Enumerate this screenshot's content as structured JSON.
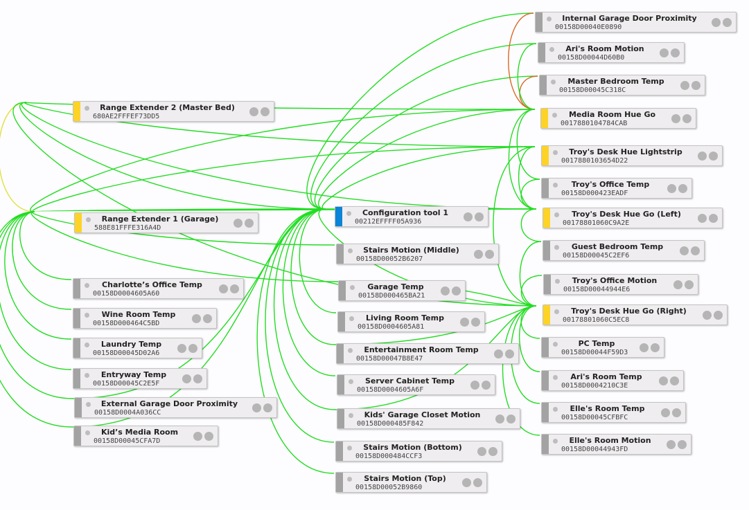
{
  "colors": {
    "router": "#fdd327",
    "coordinator": "#0a84d6",
    "end_device": "#a3a3a3",
    "link_good": "#22dd22",
    "link_weak": "#d96a2a",
    "link_mid": "#e0e040"
  },
  "nodes": [
    {
      "id": "igdp",
      "name": "Internal Garage Door Proximity",
      "ieee": "00158D00040E0890",
      "type": "end_device"
    },
    {
      "id": "arim",
      "name": "Ari's Room Motion",
      "ieee": "00158D00044D60B0",
      "type": "end_device"
    },
    {
      "id": "mbt",
      "name": "Master Bedroom Temp",
      "ieee": "00158D00045C318C",
      "type": "end_device"
    },
    {
      "id": "mrhg",
      "name": "Media Room Hue Go",
      "ieee": "0017880104784CAB",
      "type": "router"
    },
    {
      "id": "tdls",
      "name": "Troy's Desk Hue Lightstrip",
      "ieee": "0017880103654D22",
      "type": "router"
    },
    {
      "id": "tot",
      "name": "Troy's Office Temp",
      "ieee": "00158D000423EADF",
      "type": "end_device"
    },
    {
      "id": "tdgl",
      "name": "Troy's Desk Hue Go (Left)",
      "ieee": "00178801060C9A2E",
      "type": "router"
    },
    {
      "id": "gbt",
      "name": "Guest Bedroom Temp",
      "ieee": "00158D00045C2EF6",
      "type": "end_device"
    },
    {
      "id": "tom",
      "name": "Troy's Office Motion",
      "ieee": "00158D00044944E6",
      "type": "end_device"
    },
    {
      "id": "tdgr",
      "name": "Troy's Desk Hue Go (Right)",
      "ieee": "00178801060C5EC8",
      "type": "router"
    },
    {
      "id": "pct",
      "name": "PC Temp",
      "ieee": "00158D00044F59D3",
      "type": "end_device"
    },
    {
      "id": "arit",
      "name": "Ari's Room Temp",
      "ieee": "00158D0004210C3E",
      "type": "end_device"
    },
    {
      "id": "ellet",
      "name": "Elle's Room Temp",
      "ieee": "00158D00045CFBFC",
      "type": "end_device"
    },
    {
      "id": "ellem",
      "name": "Elle's Room Motion",
      "ieee": "00158D00044943FD",
      "type": "end_device"
    },
    {
      "id": "coord",
      "name": "Configuration tool 1",
      "ieee": "00212EFFFF05A936",
      "type": "coordinator"
    },
    {
      "id": "smm",
      "name": "Stairs Motion (Middle)",
      "ieee": "00158D00052B6207",
      "type": "end_device"
    },
    {
      "id": "gart",
      "name": "Garage Temp",
      "ieee": "00158D000465BA21",
      "type": "end_device"
    },
    {
      "id": "lrt",
      "name": "Living Room Temp",
      "ieee": "00158D0004605A81",
      "type": "end_device"
    },
    {
      "id": "ert",
      "name": "Entertainment Room Temp",
      "ieee": "00158D00047B8E47",
      "type": "end_device"
    },
    {
      "id": "sct",
      "name": "Server Cabinet Temp",
      "ieee": "00158D0004605A6F",
      "type": "end_device"
    },
    {
      "id": "kgcm",
      "name": "Kids' Garage Closet Motion",
      "ieee": "00158D000485F842",
      "type": "end_device"
    },
    {
      "id": "smb",
      "name": "Stairs Motion (Bottom)",
      "ieee": "00158D000484CCF3",
      "type": "end_device"
    },
    {
      "id": "smt",
      "name": "Stairs Motion (Top)",
      "ieee": "00158D00052B9860",
      "type": "end_device"
    },
    {
      "id": "re2",
      "name": "Range Extender 2 (Master Bed)",
      "ieee": "680AE2FFFEF73DD5",
      "type": "router"
    },
    {
      "id": "re1",
      "name": "Range Extender 1 (Garage)",
      "ieee": "588E81FFFE316A4D",
      "type": "router"
    },
    {
      "id": "cot",
      "name": "Charlotte’s Office Temp",
      "ieee": "00158D0004605A60",
      "type": "end_device"
    },
    {
      "id": "wrt",
      "name": "Wine Room Temp",
      "ieee": "00158D000464C5BD",
      "type": "end_device"
    },
    {
      "id": "lt",
      "name": "Laundry Temp",
      "ieee": "00158D00045D02A6",
      "type": "end_device"
    },
    {
      "id": "et",
      "name": "Entryway Temp",
      "ieee": "00158D00045C2E5F",
      "type": "end_device"
    },
    {
      "id": "egdp",
      "name": "External Garage Door Proximity",
      "ieee": "00158D0004A036CC",
      "type": "end_device"
    },
    {
      "id": "kmr",
      "name": "Kid’s Media Room",
      "ieee": "00158D00045CFA7D",
      "type": "end_device"
    }
  ],
  "links": [
    [
      "re2",
      "coord",
      "good"
    ],
    [
      "re1",
      "coord",
      "good"
    ],
    [
      "re2",
      "re1",
      "mid"
    ],
    [
      "re2",
      "mrhg",
      "good"
    ],
    [
      "re2",
      "tdls",
      "good"
    ],
    [
      "re2",
      "tdgl",
      "good"
    ],
    [
      "re2",
      "tdgr",
      "good"
    ],
    [
      "re1",
      "mrhg",
      "good"
    ],
    [
      "re1",
      "tdls",
      "good"
    ],
    [
      "re1",
      "tdgl",
      "good"
    ],
    [
      "re1",
      "cot",
      "good"
    ],
    [
      "re1",
      "wrt",
      "good"
    ],
    [
      "re1",
      "lt",
      "good"
    ],
    [
      "re1",
      "et",
      "good"
    ],
    [
      "re1",
      "egdp",
      "good"
    ],
    [
      "re1",
      "kmr",
      "good"
    ],
    [
      "re1",
      "gart",
      "good"
    ],
    [
      "re1",
      "smm",
      "good"
    ],
    [
      "coord",
      "mrhg",
      "good"
    ],
    [
      "coord",
      "tdls",
      "good"
    ],
    [
      "coord",
      "tdgl",
      "good"
    ],
    [
      "coord",
      "tdgr",
      "good"
    ],
    [
      "coord",
      "igdp",
      "good"
    ],
    [
      "coord",
      "arim",
      "good"
    ],
    [
      "coord",
      "mbt",
      "good"
    ],
    [
      "coord",
      "lrt",
      "good"
    ],
    [
      "coord",
      "ert",
      "good"
    ],
    [
      "coord",
      "sct",
      "good"
    ],
    [
      "coord",
      "kgcm",
      "good"
    ],
    [
      "coord",
      "smb",
      "good"
    ],
    [
      "coord",
      "smt",
      "good"
    ],
    [
      "coord",
      "egdp",
      "good"
    ],
    [
      "coord",
      "kmr",
      "good"
    ],
    [
      "mrhg",
      "igdp",
      "weak"
    ],
    [
      "mrhg",
      "mbt",
      "weak"
    ],
    [
      "mrhg",
      "arim",
      "good"
    ],
    [
      "mrhg",
      "tot",
      "good"
    ],
    [
      "mrhg",
      "tdgl",
      "good"
    ],
    [
      "tdgl",
      "tot",
      "good"
    ],
    [
      "tdgl",
      "gbt",
      "good"
    ],
    [
      "tdls",
      "tdgl",
      "good"
    ],
    [
      "tdls",
      "tdgr",
      "good"
    ],
    [
      "tdgr",
      "tom",
      "good"
    ],
    [
      "tdgr",
      "pct",
      "good"
    ],
    [
      "tdgr",
      "arit",
      "good"
    ],
    [
      "tdgr",
      "ellet",
      "good"
    ],
    [
      "tdgr",
      "ellem",
      "good"
    ],
    [
      "tdgr",
      "gart",
      "good"
    ],
    [
      "tdgr",
      "ert",
      "good"
    ],
    [
      "tdgr",
      "kgcm",
      "good"
    ],
    [
      "tdgr",
      "gbt",
      "good"
    ]
  ]
}
